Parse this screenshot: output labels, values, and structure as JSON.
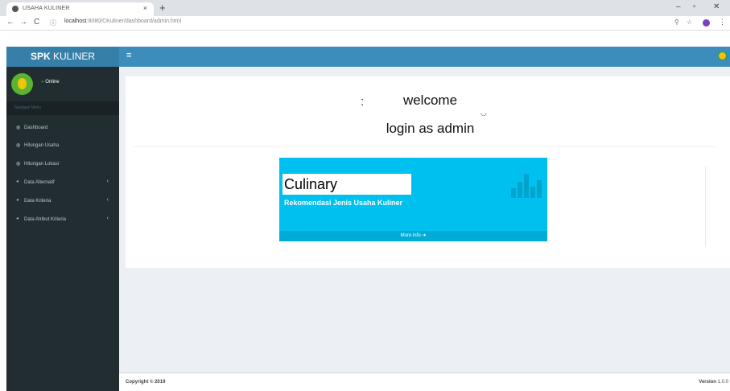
{
  "browser": {
    "tab_title": "USAHA KULINER",
    "tab_close": "×",
    "new_tab": "+",
    "win_min": "–",
    "win_max": "▫",
    "win_close": "✕",
    "nav_back": "←",
    "nav_forward": "→",
    "nav_reload": "C",
    "url_host": "localhost",
    "url_path": ":8080/CKuliner/dashboard/admin.html"
  },
  "header": {
    "logo_bold": "SPK",
    "logo_rest": " KULINER",
    "toggle_icon": "≡"
  },
  "sidebar": {
    "status": "Online",
    "nav_header": "Navigasi Menu",
    "items": [
      {
        "label": "Dashboard",
        "icon": "dashboard-icon",
        "caret": ""
      },
      {
        "label": "Hitungan Usaha",
        "icon": "dashboard-icon",
        "caret": ""
      },
      {
        "label": "Hitungan Lokasi",
        "icon": "dashboard-icon",
        "caret": ""
      },
      {
        "label": "Data Alternatif",
        "icon": "pie-icon",
        "caret": "‹"
      },
      {
        "label": "Data Kriteria",
        "icon": "pie-icon",
        "caret": "‹"
      },
      {
        "label": "Data Atribut Kriteria",
        "icon": "pie-icon",
        "caret": "‹"
      }
    ]
  },
  "main": {
    "welcome": "welcome",
    "login_as": "login as admin",
    "box_title": "Culinary",
    "box_subtitle": "Rekomendasi Jenis Usaha Kuliner",
    "more_info": "More info"
  },
  "footer": {
    "copyright": "Copyright © 2019",
    "version_label": "Version",
    "version_value": "1.0.0"
  },
  "colors": {
    "header_bg": "#3c8dbc",
    "logo_bg": "#367fa9",
    "sidebar_bg": "#222d32",
    "info_box": "#00c0ef"
  }
}
